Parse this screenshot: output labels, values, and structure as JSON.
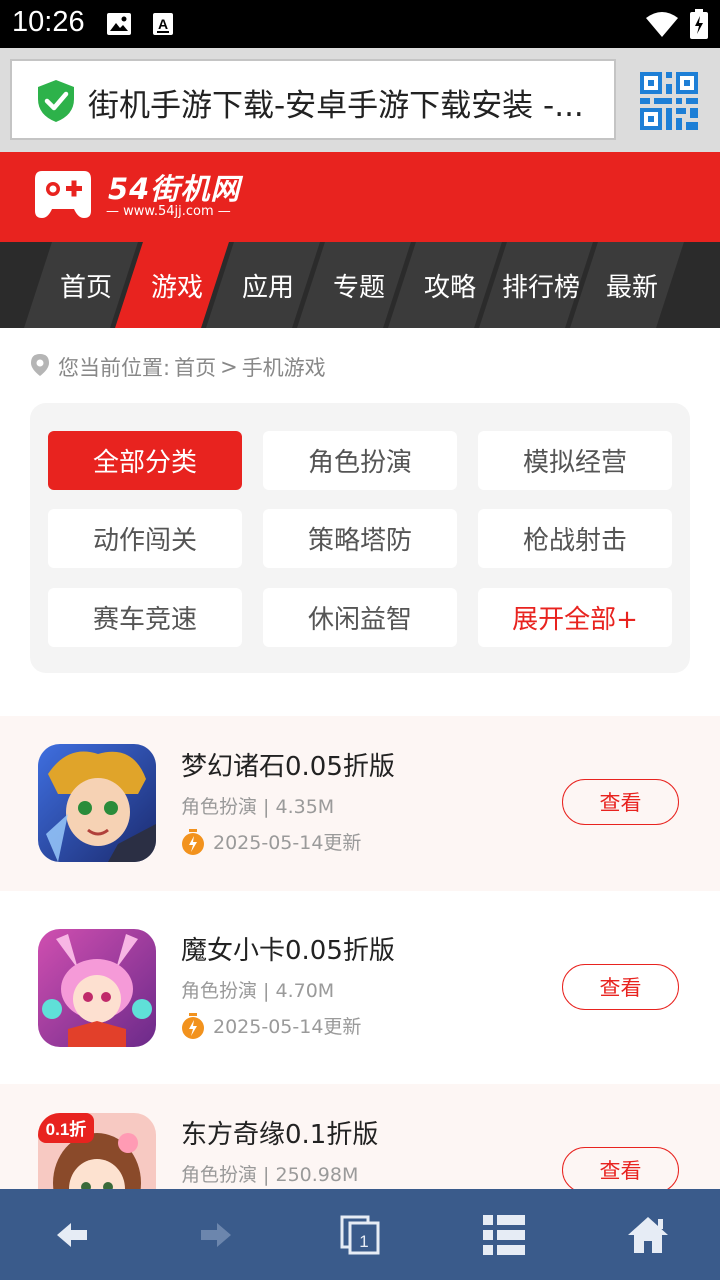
{
  "status_bar": {
    "time": "10:26"
  },
  "address_bar": {
    "page_title": "街机手游下载-安卓手游下载安装 -..."
  },
  "site": {
    "logo_text": "54街机网",
    "logo_subtext": "— www.54jj.com —",
    "brand_color": "#e8231f"
  },
  "nav": {
    "items": [
      {
        "label": "首页",
        "active": false
      },
      {
        "label": "游戏",
        "active": true
      },
      {
        "label": "应用",
        "active": false
      },
      {
        "label": "专题",
        "active": false
      },
      {
        "label": "攻略",
        "active": false
      },
      {
        "label": "排行榜",
        "active": false
      },
      {
        "label": "最新",
        "active": false
      }
    ]
  },
  "breadcrumb": {
    "prefix": "您当前位置:",
    "home": "首页",
    "separator": ">",
    "current": "手机游戏"
  },
  "categories": [
    {
      "label": "全部分类",
      "state": "active"
    },
    {
      "label": "角色扮演",
      "state": "normal"
    },
    {
      "label": "模拟经营",
      "state": "normal"
    },
    {
      "label": "动作闯关",
      "state": "normal"
    },
    {
      "label": "策略塔防",
      "state": "normal"
    },
    {
      "label": "枪战射击",
      "state": "normal"
    },
    {
      "label": "赛车竞速",
      "state": "normal"
    },
    {
      "label": "休闲益智",
      "state": "normal"
    },
    {
      "label": "展开全部+",
      "state": "more"
    }
  ],
  "games": [
    {
      "title": "梦幻诸石0.05折版",
      "meta": "角色扮演 | 4.35M",
      "date": "2025-05-14更新",
      "button": "查看"
    },
    {
      "title": "魔女小卡0.05折版",
      "meta": "角色扮演 | 4.70M",
      "date": "2025-05-14更新",
      "button": "查看"
    },
    {
      "title": "东方奇缘0.1折版",
      "meta": "角色扮演 | 250.98M",
      "date": "",
      "button": "查看",
      "icon_badge": "0.1折"
    }
  ],
  "toolbar": {
    "icons": [
      "back-icon",
      "forward-icon",
      "tabs-icon",
      "menu-icon",
      "home-icon"
    ],
    "tab_count": "1"
  }
}
